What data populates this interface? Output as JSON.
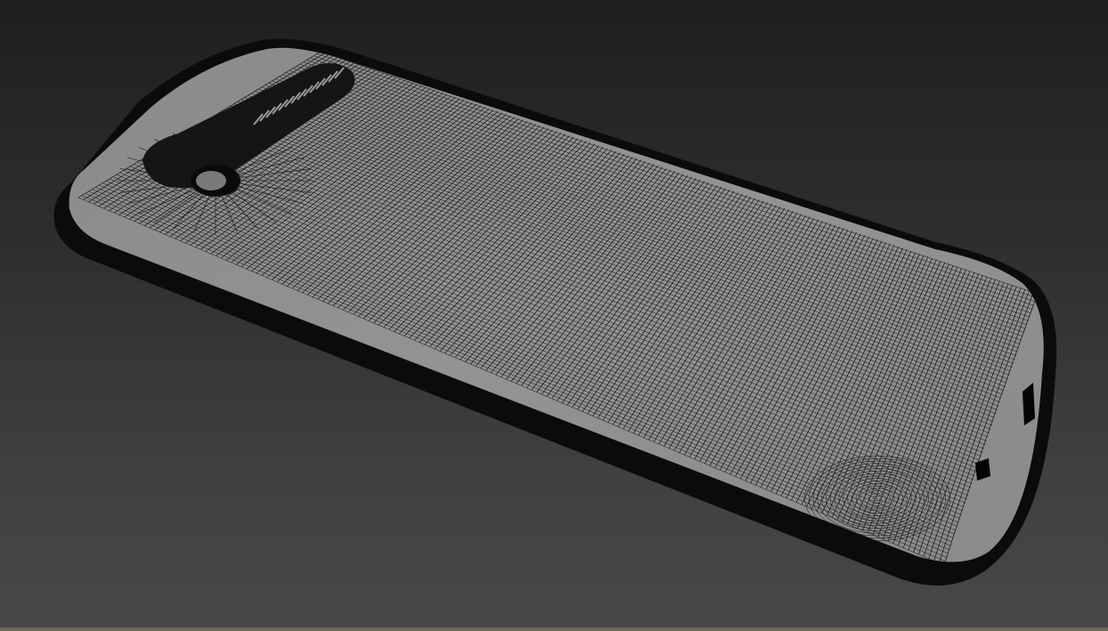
{
  "viewport": {
    "background_top": "#1f1f1f",
    "background_bottom": "#484848"
  },
  "model": {
    "shading": "wireframe",
    "surface_color": "#8f8f8f",
    "edge_color": "#0b0b0b",
    "wire_color": "#111111",
    "lens_color": "#7a7a7a"
  },
  "status_strip_color": "#6b6b50"
}
